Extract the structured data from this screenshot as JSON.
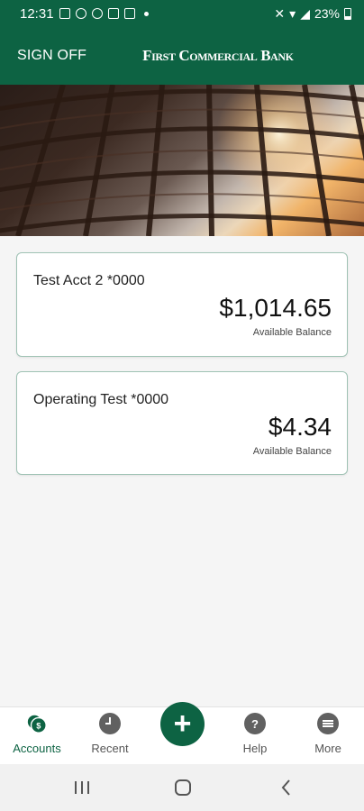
{
  "status_bar": {
    "time": "12:31",
    "battery": "23%"
  },
  "header": {
    "sign_off_label": "SIGN OFF",
    "logo_text": "First Commercial Bank"
  },
  "accounts": [
    {
      "name": "Test Acct 2 *0000",
      "balance": "$1,014.65",
      "balance_caption": "Available Balance"
    },
    {
      "name": "Operating Test *0000",
      "balance": "$4.34",
      "balance_caption": "Available Balance"
    }
  ],
  "bottom_nav": {
    "items": [
      {
        "label": "Accounts",
        "icon": "accounts-icon",
        "active": true
      },
      {
        "label": "Recent",
        "icon": "clock-icon",
        "active": false
      },
      {
        "label": "Help",
        "icon": "help-icon",
        "active": false
      },
      {
        "label": "More",
        "icon": "more-icon",
        "active": false
      }
    ],
    "fab_icon": "+"
  },
  "colors": {
    "brand_green": "#0d6343",
    "card_border": "#9fc2b4",
    "background": "#f5f5f5"
  }
}
